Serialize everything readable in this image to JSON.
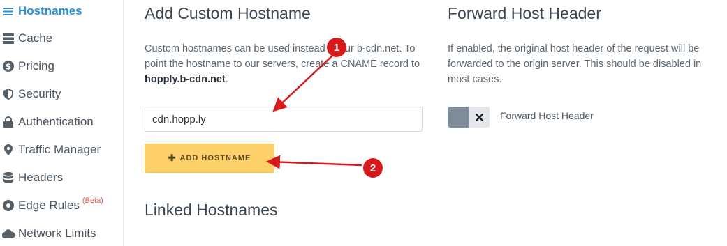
{
  "sidebar": {
    "items": [
      {
        "label": "Hostnames",
        "icon": "menu-icon",
        "active": true
      },
      {
        "label": "Cache",
        "icon": "server-icon"
      },
      {
        "label": "Pricing",
        "icon": "dollar-icon"
      },
      {
        "label": "Security",
        "icon": "shield-icon"
      },
      {
        "label": "Authentication",
        "icon": "lock-icon"
      },
      {
        "label": "Traffic Manager",
        "icon": "map-pin-icon"
      },
      {
        "label": "Headers",
        "icon": "database-icon"
      },
      {
        "label": "Edge Rules",
        "icon": "circle-dot-icon",
        "badge": "(Beta)"
      },
      {
        "label": "Network Limits",
        "icon": "cloud-icon"
      }
    ]
  },
  "custom_hostname": {
    "title": "Add Custom Hostname",
    "description_1": "Custom hostnames can be used instead of our b-cdn.net. To point the hostname to our servers, create a CNAME record to ",
    "cname_target": "hopply.b-cdn.net",
    "description_end": ".",
    "input_value": "cdn.hopp.ly",
    "add_button_label": "ADD HOSTNAME"
  },
  "forward_host_header": {
    "title": "Forward Host Header",
    "description": "If enabled, the original host header of the request will be forwarded to the origin server. This should be disabled in most cases.",
    "toggle_label": "Forward Host Header",
    "enabled": false
  },
  "linked_hostnames": {
    "title": "Linked Hostnames"
  },
  "annotations": {
    "badge_1": "1",
    "badge_2": "2"
  },
  "colors": {
    "accent": "#2b8fd6",
    "button_yellow": "#fdd06a",
    "annotation_red": "#d7191c",
    "beta_red": "#e0584d"
  }
}
